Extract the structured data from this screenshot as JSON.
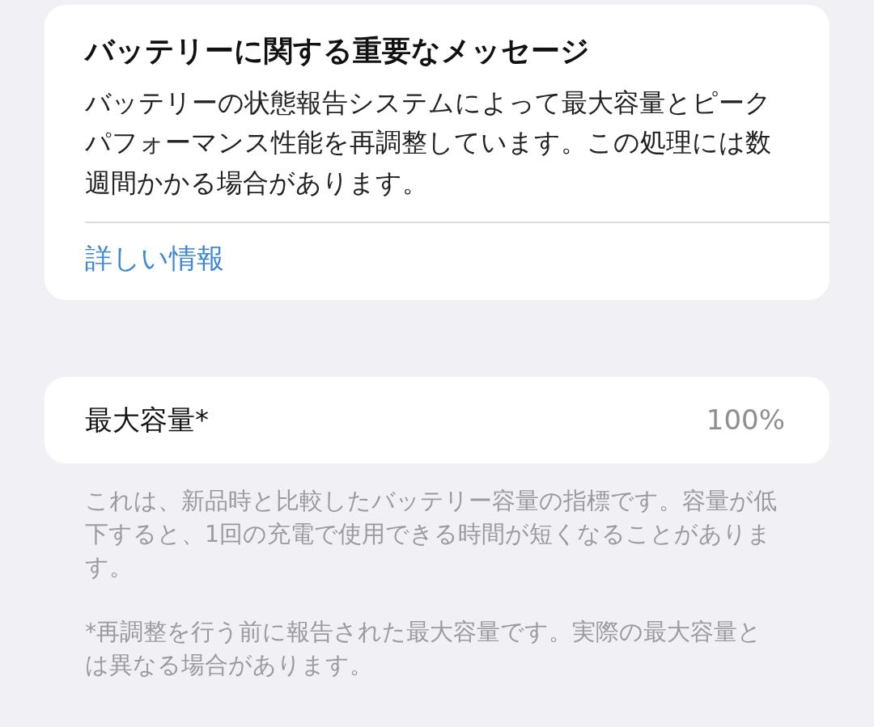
{
  "message_card": {
    "title": "バッテリーに関する重要なメッセージ",
    "body": "バッテリーの状態報告システムによって最大容量とピークパフォーマンス性能を再調整しています。この処理には数週間かかる場合があります。",
    "link": "詳しい情報"
  },
  "capacity": {
    "label": "最大容量*",
    "value": "100%"
  },
  "notes": [
    "これは、新品時と比較したバッテリー容量の指標です。容量が低下すると、1回の充電で使用できる時間が短くなることがあります。",
    "*再調整を行う前に報告された最大容量です。実際の最大容量とは異なる場合があります。"
  ]
}
